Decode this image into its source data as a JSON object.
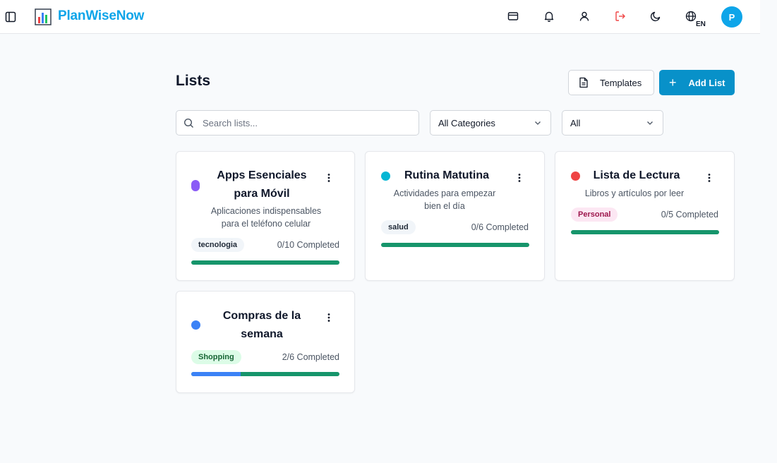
{
  "app": {
    "title": "PlanWiseNow",
    "language": "EN",
    "avatar_initial": "P"
  },
  "topbar": {
    "icons": [
      "sidebar-toggle-icon",
      "credit-card-icon",
      "bell-icon",
      "user-icon",
      "logout-icon",
      "moon-icon",
      "globe-icon"
    ],
    "logout_color": "#ef4444"
  },
  "page": {
    "title": "Lists",
    "templates_label": "Templates",
    "add_list_label": "Add List",
    "search_placeholder": "Search lists...",
    "category_filter": "All Categories",
    "status_filter": "All"
  },
  "colors": {
    "accent": "#0891c9",
    "brand": "#0ea5e9",
    "progress": "#16956b",
    "progress_done": "#3b82f6"
  },
  "lists": [
    {
      "title_line1": "Apps Esenciales",
      "title_line2": "para Móvil",
      "desc_line1": "Aplicaciones indispensables",
      "desc_line2": "para el teléfono celular",
      "tag": "tecnologia",
      "tag_bg": "#f1f5f9",
      "tag_color": "#1f2937",
      "completed": 0,
      "total": 10,
      "count_text": "0/10 Completed",
      "dot_color": "#8b5cf6"
    },
    {
      "title_line1": "Rutina Matutina",
      "title_line2": "",
      "desc_line1": "Actividades para empezar",
      "desc_line2": "bien el día",
      "tag": "salud",
      "tag_bg": "#f1f5f9",
      "tag_color": "#1f2937",
      "completed": 0,
      "total": 6,
      "count_text": "0/6 Completed",
      "dot_color": "#06b6d4"
    },
    {
      "title_line1": "Lista de Lectura",
      "title_line2": "",
      "desc_line1": "Libros y artículos por leer",
      "desc_line2": "",
      "tag": "Personal",
      "tag_bg": "#fce7f3",
      "tag_color": "#9d174d",
      "completed": 0,
      "total": 5,
      "count_text": "0/5 Completed",
      "dot_color": "#ef4444"
    },
    {
      "title_line1": "Compras de la",
      "title_line2": "semana",
      "desc_line1": "",
      "desc_line2": "",
      "tag": "Shopping",
      "tag_bg": "#dcfce7",
      "tag_color": "#166534",
      "completed": 2,
      "total": 6,
      "count_text": "2/6 Completed",
      "dot_color": "#3b82f6"
    }
  ]
}
